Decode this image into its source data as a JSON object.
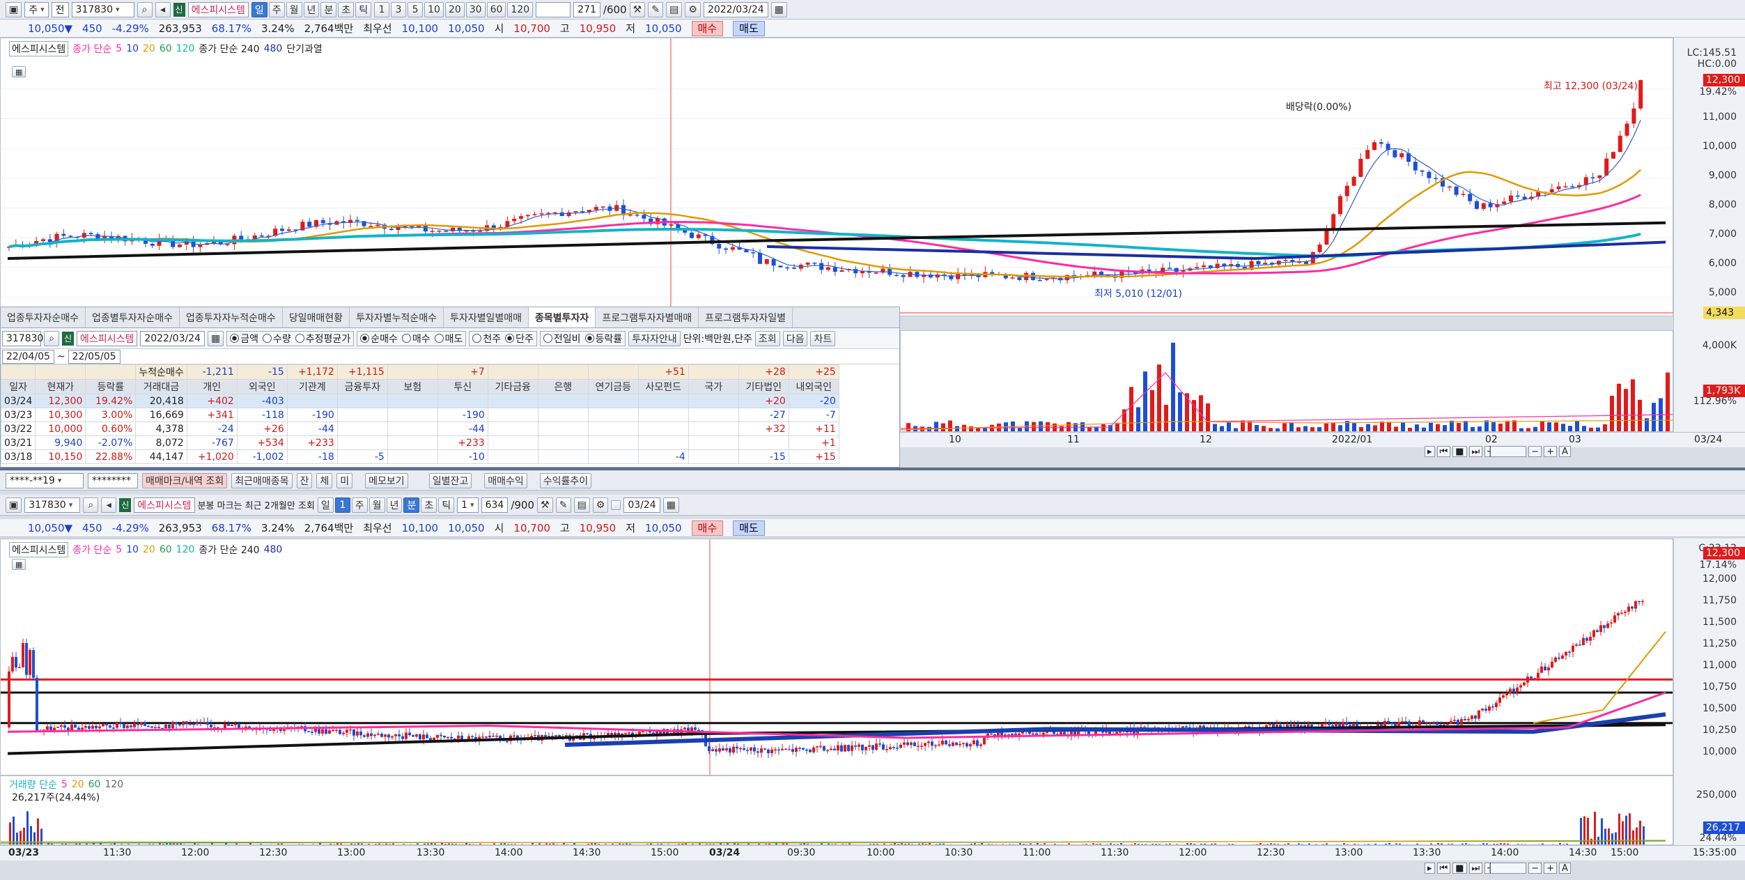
{
  "top": {
    "toolbar": {
      "mode": "주",
      "kind": "전",
      "code": "317830",
      "name": "에스피시스템",
      "sin": "신",
      "periods": [
        "일",
        "주",
        "월",
        "년",
        "분",
        "초",
        "틱"
      ],
      "period_selected": "일",
      "nums": [
        "1",
        "3",
        "5",
        "10",
        "20",
        "30",
        "60",
        "120"
      ],
      "count": "271",
      "total": "/600",
      "date": "2022/03/24"
    },
    "quote": {
      "price": "10,050",
      "arrow": "▼",
      "change": "450",
      "rate": "-4.29%",
      "volume": "263,953",
      "vol_ratio": "68.17%",
      "turnover": "3.24%",
      "amount": "2,764백만",
      "best_label": "최우선",
      "best_ask": "10,100",
      "best_bid": "10,050",
      "open_label": "시",
      "open": "10,700",
      "high_label": "고",
      "high": "10,950",
      "low_label": "저",
      "low": "10,050",
      "buy": "매수",
      "sell": "매도"
    },
    "legend": {
      "name": "에스피시스템",
      "ma_label": "종가 단순",
      "ma": [
        "5",
        "10",
        "20",
        "60",
        "120"
      ],
      "ma2_label": "종가 단순 240",
      "ma2": "480",
      "extra": "단기과열"
    },
    "axis_labels": [
      "LC:145.51",
      "HC:0.00",
      "12,300",
      "19.42%",
      "11,000",
      "10,000",
      "9,000",
      "8,000",
      "7,000",
      "6,000",
      "5,000",
      "4,343"
    ],
    "annotations": {
      "high": "최고 12,300 (03/24)",
      "low": "최저 5,010 (12/01)",
      "div": "배당락(0.00%)"
    },
    "vol_axis": [
      "4,000K",
      "1,793K",
      "112.96%"
    ],
    "xaxis": [
      "10",
      "11",
      "12",
      "2022/01",
      "02",
      "03",
      "03/24"
    ]
  },
  "panel": {
    "tabs": [
      "업종투자자순매수",
      "업종별투자자순매수",
      "업종투자자누적순매수",
      "당일매매현황",
      "투자자별누적순매수",
      "투자자별일별매매",
      "종목별투자자",
      "프로그램투자자별매매",
      "프로그램투자자일별"
    ],
    "tab_active": "종목별투자자",
    "controls": {
      "code": "317830",
      "name": "에스피시스템",
      "date": "2022/03/24",
      "r1": [
        "금액",
        "수량",
        "추정평균가"
      ],
      "r1_on": "금액",
      "r2": [
        "순매수",
        "매수",
        "매도"
      ],
      "r2_on": "순매수",
      "r3": [
        "천주",
        "단주"
      ],
      "r3_on": "단주",
      "r4": [
        "전일비",
        "등락률"
      ],
      "r4_on": "등락률",
      "guide": "투자자안내",
      "unit": "단위:백만원,단주",
      "query": "조회",
      "next": "다음",
      "chart": "차트"
    },
    "range": {
      "from": "22/04/05",
      "to": "22/05/05",
      "label": "누적순매수",
      "sums": [
        "-1,211",
        "-15",
        "+1,172",
        "+1,115",
        "",
        "+7",
        "",
        "",
        "",
        "+51",
        "",
        "+28",
        "+25"
      ]
    },
    "headers": [
      "일자",
      "현재가",
      "등락률",
      "거래대금",
      "개인",
      "외국인",
      "기관계",
      "금융투자",
      "보험",
      "투신",
      "기타금융",
      "은행",
      "연기금등",
      "사모펀드",
      "국가",
      "기타법인",
      "내외국인"
    ],
    "rows": [
      [
        "03/24",
        "12,300",
        "19.42%",
        "20,418",
        "+402",
        "-403",
        "",
        "",
        "",
        "",
        "",
        "",
        "",
        "",
        "",
        "+20",
        "-20"
      ],
      [
        "03/23",
        "10,300",
        "3.00%",
        "16,669",
        "+341",
        "-118",
        "-190",
        "",
        "",
        "-190",
        "",
        "",
        "",
        "",
        "",
        "-27",
        "-7"
      ],
      [
        "03/22",
        "10,000",
        "0.60%",
        "4,378",
        "-24",
        "+26",
        "-44",
        "",
        "",
        "-44",
        "",
        "",
        "",
        "",
        "",
        "+32",
        "+11"
      ],
      [
        "03/21",
        "9,940",
        "-2.07%",
        "8,072",
        "-767",
        "+534",
        "+233",
        "",
        "",
        "+233",
        "",
        "",
        "",
        "",
        "",
        "",
        "+1"
      ],
      [
        "03/18",
        "10,150",
        "22.88%",
        "44,147",
        "+1,020",
        "-1,002",
        "-18",
        "-5",
        "",
        "-10",
        "",
        "",
        "",
        "-4",
        "",
        "-15",
        "+15"
      ]
    ]
  },
  "bottom": {
    "account": "****-**19",
    "password": "********",
    "buttons": [
      "매매마크/내역 조회",
      "최근매매종목",
      "잔",
      "체",
      "미",
      "메모보기",
      "일별잔고",
      "매매수익",
      "수익률추이"
    ],
    "toolbar": {
      "code": "317830",
      "name": "에스피시스템",
      "note": "분봉 마크는 최근 2개월만 조회",
      "periods": [
        "일",
        "1",
        "주",
        "월",
        "년",
        "분",
        "초",
        "틱"
      ],
      "period_selected": "분",
      "interval": "1",
      "count": "634",
      "total": "/900",
      "date": "03/24"
    },
    "quote": {
      "price": "10,050",
      "arrow": "▼",
      "change": "450",
      "rate": "-4.29%",
      "volume": "263,953",
      "vol_ratio": "68.17%",
      "turnover": "3.24%",
      "amount": "2,764백만",
      "best_label": "최우선",
      "best_ask": "10,100",
      "best_bid": "10,050",
      "open_label": "시",
      "open": "10,700",
      "high_label": "고",
      "high": "10,950",
      "low_label": "저",
      "low": "10,050",
      "buy": "매수",
      "sell": "매도"
    },
    "legend": {
      "name": "에스피시스템",
      "ma_label": "종가 단순",
      "ma": [
        "5",
        "10",
        "20",
        "60",
        "120"
      ],
      "ma2_label": "종가 단순 240",
      "ma2": "480"
    },
    "axis_labels": [
      "C:23.12",
      "12,300",
      "17.14%",
      "12,000",
      "11,750",
      "11,500",
      "11,250",
      "11,000",
      "10,750",
      "10,500",
      "10,250",
      "10,000"
    ],
    "vol_legend": {
      "label": "거래량 단순",
      "ma": [
        "5",
        "20",
        "60",
        "120"
      ],
      "value": "26,217주(24.44%)"
    },
    "vol_axis": [
      "250,000",
      "26,217",
      "24.44%"
    ],
    "xaxis": [
      "03/23",
      "11:30",
      "12:00",
      "12:30",
      "13:00",
      "13:30",
      "14:00",
      "14:30",
      "15:00",
      "03/24",
      "09:30",
      "10:00",
      "10:30",
      "11:00",
      "11:30",
      "12:00",
      "12:30",
      "13:00",
      "13:30",
      "14:00",
      "14:30",
      "15:00",
      "15:35:00"
    ]
  },
  "colors": {
    "up": "#e21a1a",
    "down": "#1c4fd6",
    "ma5": "#ff2aa0",
    "ma20": "#e09a00",
    "ma60": "#12b4c8",
    "ma240": "#111111",
    "ma480": "#1a2fa0"
  }
}
